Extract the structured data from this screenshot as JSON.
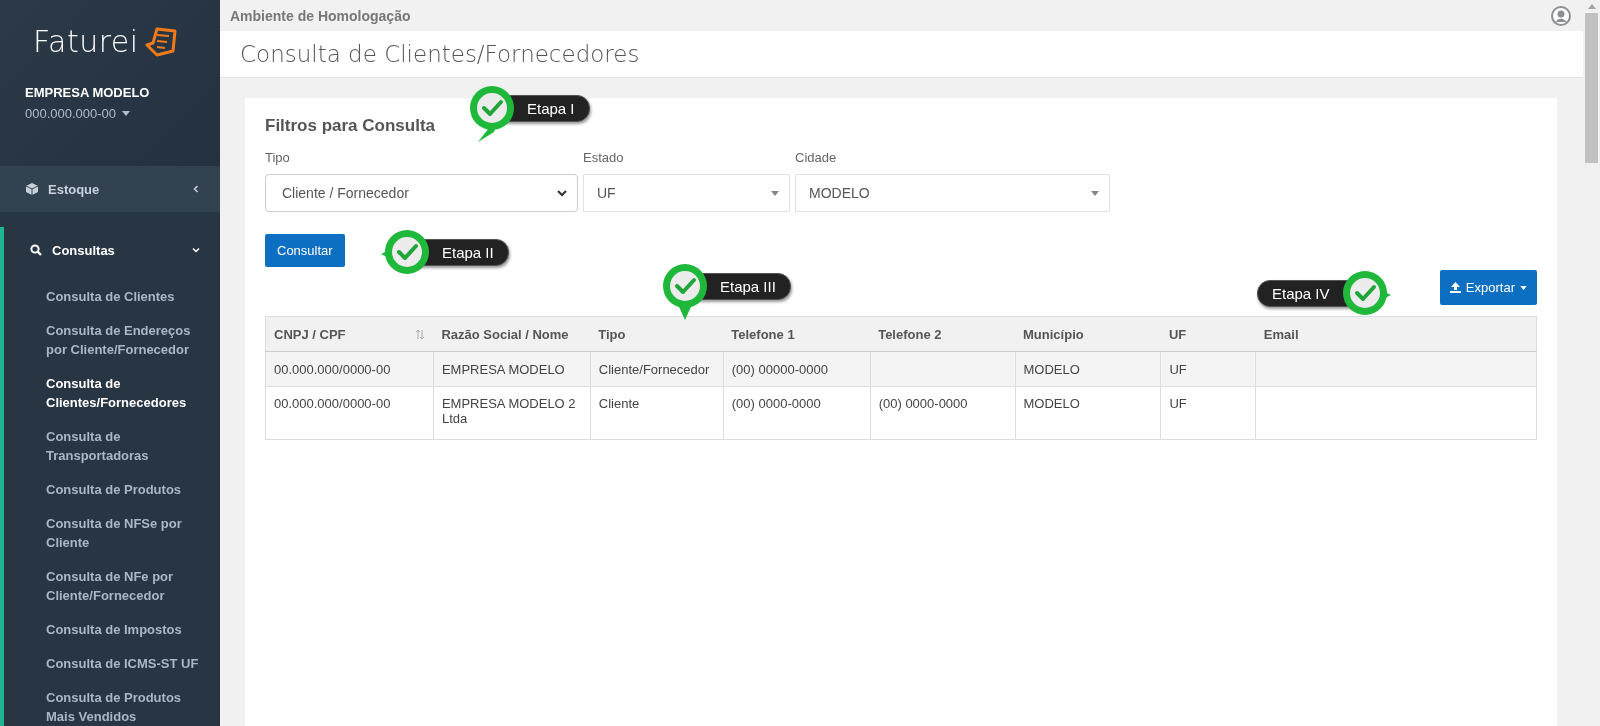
{
  "sidebar": {
    "logo": "Faturei",
    "company": {
      "name": "EMPRESA MODELO",
      "document": "000.000.000-00"
    },
    "menu": [
      {
        "label": "Estoque",
        "expanded": false
      },
      {
        "label": "Consultas",
        "expanded": true,
        "children": [
          {
            "label": "Consulta de Clientes",
            "selected": false
          },
          {
            "label": "Consulta de Endereços por Cliente/Fornecedor",
            "selected": false
          },
          {
            "label": "Consulta de Clientes/Fornecedores",
            "selected": true
          },
          {
            "label": "Consulta de Transportadoras",
            "selected": false
          },
          {
            "label": "Consulta de Produtos",
            "selected": false
          },
          {
            "label": "Consulta de NFSe por Cliente",
            "selected": false
          },
          {
            "label": "Consulta de NFe por Cliente/Fornecedor",
            "selected": false
          },
          {
            "label": "Consulta de Impostos",
            "selected": false
          },
          {
            "label": "Consulta de ICMS-ST UF",
            "selected": false
          },
          {
            "label": "Consulta de Produtos Mais Vendidos",
            "selected": false
          }
        ]
      }
    ]
  },
  "topbar": {
    "environment": "Ambiente de Homologação"
  },
  "page_title": "Consulta de Clientes/Fornecedores",
  "filters": {
    "title": "Filtros para Consulta",
    "fields": [
      {
        "label": "Tipo",
        "value": "Cliente / Fornecedor",
        "kind": "native"
      },
      {
        "label": "Estado",
        "value": "UF",
        "kind": "custom"
      },
      {
        "label": "Cidade",
        "value": "MODELO",
        "kind": "custom"
      }
    ],
    "submit": "Consultar"
  },
  "export_button": "Exportar",
  "table": {
    "columns": [
      {
        "label": "CNPJ / CPF",
        "sortable": true
      },
      {
        "label": "Razão Social / Nome",
        "sortable": false
      },
      {
        "label": "Tipo",
        "sortable": false
      },
      {
        "label": "Telefone 1",
        "sortable": false
      },
      {
        "label": "Telefone 2",
        "sortable": false
      },
      {
        "label": "Município",
        "sortable": false
      },
      {
        "label": "UF",
        "sortable": false
      },
      {
        "label": "Email",
        "sortable": false
      }
    ],
    "rows": [
      [
        "00.000.000/0000-00",
        "EMPRESA MODELO",
        "Cliente/Fornecedor",
        "(00) 00000-0000",
        "",
        "MODELO",
        "UF",
        ""
      ],
      [
        "00.000.000/0000-00",
        "EMPRESA MODELO 2\nLtda",
        "Cliente",
        "(00) 0000-0000",
        "(00) 0000-0000",
        "MODELO",
        "UF",
        ""
      ]
    ]
  },
  "callouts": [
    {
      "label": "Etapa I"
    },
    {
      "label": "Etapa II"
    },
    {
      "label": "Etapa III"
    },
    {
      "label": "Etapa IV"
    }
  ]
}
